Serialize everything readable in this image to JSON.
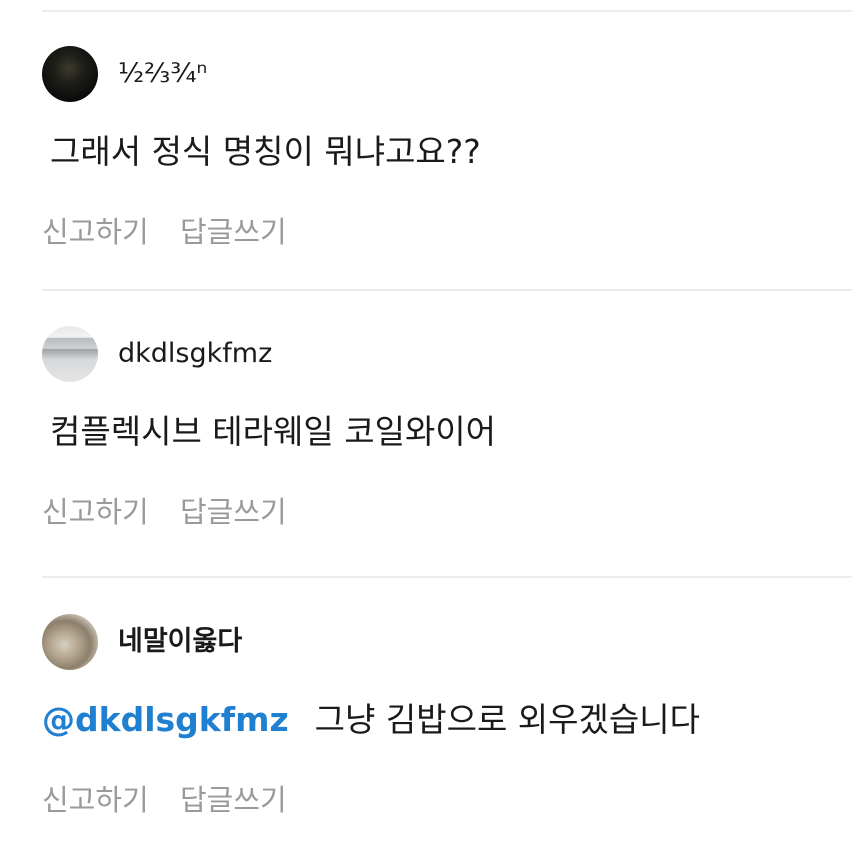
{
  "comments": [
    {
      "username": "½⅔¾ⁿ",
      "text": "그래서 정식 명칭이 뭐냐고요??",
      "mention": "",
      "report_label": "신고하기",
      "reply_label": "답글쓰기"
    },
    {
      "username": "dkdlsgkfmz",
      "text": "컴플렉시브 테라웨일 코일와이어",
      "mention": "",
      "report_label": "신고하기",
      "reply_label": "답글쓰기"
    },
    {
      "username": "네말이옳다",
      "mention": "@dkdlsgkfmz",
      "text": "그냥 김밥으로 외우겠습니다",
      "report_label": "신고하기",
      "reply_label": "답글쓰기"
    }
  ],
  "colors": {
    "mention": "#1f7fd1",
    "action_text": "#9a9a9a",
    "divider": "#ececec"
  }
}
